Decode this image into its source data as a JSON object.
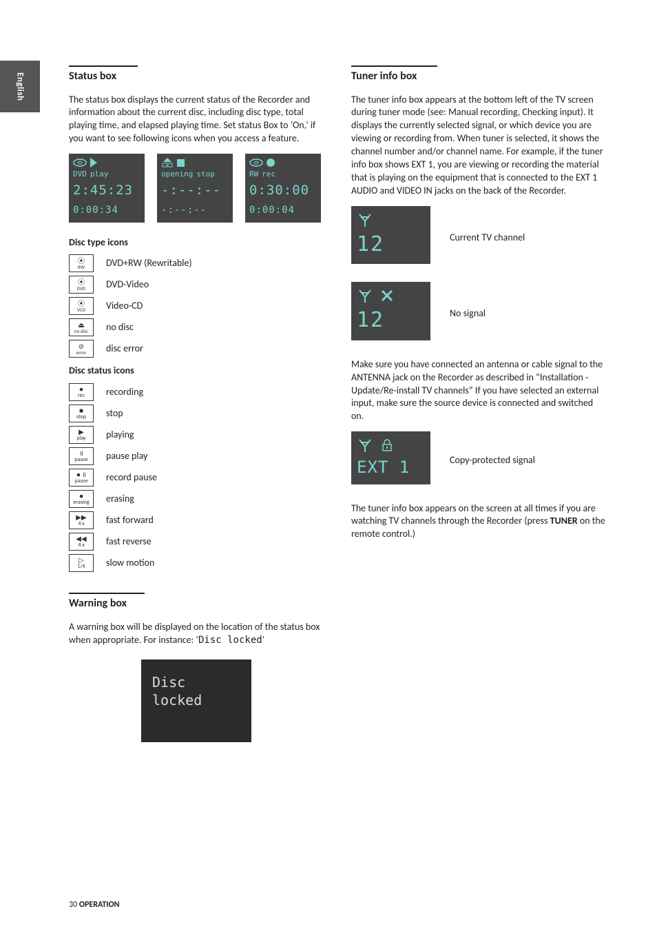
{
  "lang_tab": "English",
  "left": {
    "status_title": "Status box",
    "status_para": "The status box displays the current status of the Recorder and information about the current disc, including disc type, total playing time, and elapsed playing time. Set status Box to ‘On,’ if you want to see following icons when you access a feature.",
    "osd": {
      "play": {
        "disc_label": "DVD",
        "state": "play",
        "t1": "2:45:23",
        "t2": "0:00:34"
      },
      "open": {
        "state_a": "opening",
        "state_b": "stop",
        "t1": "-:--:--",
        "t2": "-:--:--"
      },
      "rec": {
        "disc_label": "RW",
        "state": "rec",
        "t1": "0:30:00",
        "t2": "0:00:04"
      }
    },
    "disc_type_title": "Disc type icons",
    "disc_types": [
      {
        "icon_top": "⦿",
        "icon_bot": "RW",
        "label": "DVD+RW (Rewritable)"
      },
      {
        "icon_top": "⦿",
        "icon_bot": "DVD",
        "label": "DVD-Video"
      },
      {
        "icon_top": "⦿",
        "icon_bot": "VCD",
        "label": "Video-CD"
      },
      {
        "icon_top": "⏏",
        "icon_bot": "no disc",
        "label": "no disc"
      },
      {
        "icon_top": "⊘",
        "icon_bot": "error",
        "label": "disc error"
      }
    ],
    "disc_status_title": "Disc status icons",
    "disc_status": [
      {
        "icon_top": "●",
        "icon_bot": "rec",
        "label": "recording"
      },
      {
        "icon_top": "■",
        "icon_bot": "stop",
        "label": "stop"
      },
      {
        "icon_top": "▶",
        "icon_bot": "play",
        "label": "playing"
      },
      {
        "icon_top": "॥",
        "icon_bot": "pause",
        "label": "pause play"
      },
      {
        "icon_top": "● ॥",
        "icon_bot": "pause",
        "label": "record pause"
      },
      {
        "icon_top": "●",
        "icon_bot": "erasing",
        "label": "erasing"
      },
      {
        "icon_top": "▶▶",
        "icon_bot": "4 x",
        "label": "fast forward"
      },
      {
        "icon_top": "◀◀",
        "icon_bot": "4 x",
        "label": "fast reverse"
      },
      {
        "icon_top": "▷",
        "icon_bot": "1/4",
        "label": "slow motion"
      }
    ],
    "warning_title": "Warning box",
    "warning_para_a": "A warning box will be displayed on the location of the status box when appropriate. For instance: ‘",
    "warning_para_b": "Disc locked",
    "warning_para_c": "’",
    "warn_box_line1": "Disc",
    "warn_box_line2": "locked"
  },
  "right": {
    "tuner_title": "Tuner info box",
    "tuner_para1": "The tuner info box appears at the bottom left of the TV screen during tuner mode (see: Manual recording, Checking input). It displays the currently selected signal, or which device you are viewing or recording from. When tuner is selected, it shows the channel number and/or channel name. For example, if the tuner info box shows EXT 1, you are viewing or recording the material that is playing on the equipment that is connected to the EXT 1 AUDIO and VIDEO IN jacks on the back of the Recorder.",
    "tuner_ch_label": "Current TV channel",
    "tuner_ch_num": "12",
    "tuner_nosig_label": "No signal",
    "tuner_nosig_num": "12",
    "tuner_para2": "Make sure you have connected an antenna or cable signal to the ANTENNA jack on the Recorder as described in “Installation - Update/Re-install TV channels” If you have selected an external input, make sure the source device is connected and switched on.",
    "tuner_copy_label": "Copy-protected signal",
    "tuner_copy_text": "EXT 1",
    "tuner_para3_a": "The tuner info box appears on the screen at all times if you are watching TV channels through the Recorder (press ",
    "tuner_para3_b": "TUNER",
    "tuner_para3_c": " on the remote control.)"
  },
  "footer_num": "30",
  "footer_label": "OPERATION"
}
